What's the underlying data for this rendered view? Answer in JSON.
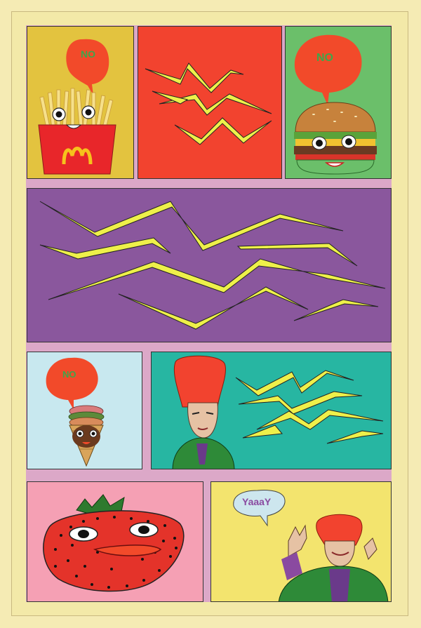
{
  "colors": {
    "page_background": "#f5ebb4",
    "gutter": "#dca8c8",
    "panel_fries": "#e3c33f",
    "panel_red": "#f2432f",
    "panel_burger": "#6bbf6a",
    "panel_purple": "#8a579d",
    "panel_icecream": "#c8e8ef",
    "panel_teal": "#27b6a2",
    "panel_strawberry": "#f5a0b4",
    "panel_yellow": "#f3e46e",
    "bubble_red": "#f24a2a",
    "bubble_blue": "#cde6ee",
    "zigzag_yellow": "#eef04a"
  },
  "panels": {
    "fries": {
      "speech": "NO",
      "icon": "fries-character-icon"
    },
    "red_zigzag": {
      "icon": "zigzag-lines-icon"
    },
    "burger": {
      "speech": "NO",
      "icon": "burger-character-icon"
    },
    "purple_zigzag": {
      "icon": "zigzag-lines-icon"
    },
    "icecream": {
      "speech": "NO",
      "icon": "icecream-character-icon"
    },
    "teal_woman": {
      "icon": "red-haired-woman-icon"
    },
    "strawberry": {
      "icon": "strawberry-face-icon"
    },
    "yaaay": {
      "speech": "YaaaY",
      "icon": "red-haired-woman-waving-icon"
    }
  }
}
